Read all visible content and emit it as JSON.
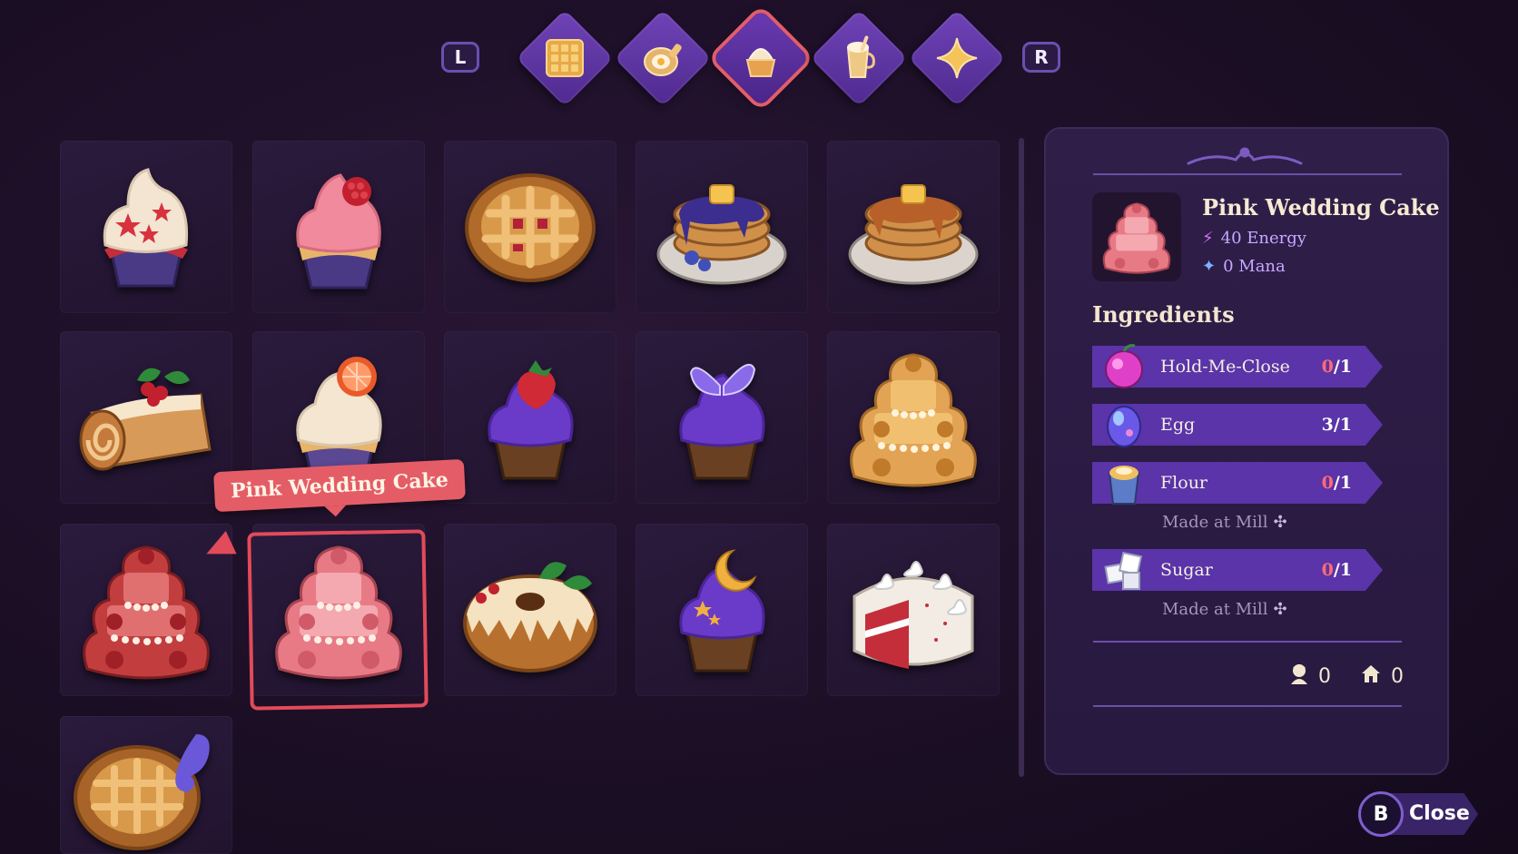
{
  "tabs": {
    "left_shoulder": "L",
    "right_shoulder": "R",
    "items": [
      {
        "icon": "waffle-icon"
      },
      {
        "icon": "pan-icon"
      },
      {
        "icon": "cupcake-icon",
        "active": true
      },
      {
        "icon": "drink-icon"
      },
      {
        "icon": "sparkle-icon"
      }
    ]
  },
  "grid": {
    "items": [
      {
        "name": "star-cupcake"
      },
      {
        "name": "raspberry-cupcake"
      },
      {
        "name": "lattice-pie"
      },
      {
        "name": "blueberry-pancakes"
      },
      {
        "name": "syrup-pancakes"
      },
      {
        "name": "holly-log-cake"
      },
      {
        "name": "grapefruit-cupcake"
      },
      {
        "name": "strawberry-purple-cupcake"
      },
      {
        "name": "butterfly-cupcake"
      },
      {
        "name": "golden-wedding-cake"
      },
      {
        "name": "red-wedding-cake"
      },
      {
        "name": "pink-wedding-cake",
        "selected": true
      },
      {
        "name": "bundt-cake"
      },
      {
        "name": "moon-cupcake"
      },
      {
        "name": "red-velvet-cake"
      },
      {
        "name": "berry-pie"
      }
    ],
    "tooltip": "Pink Wedding Cake"
  },
  "detail": {
    "title": "Pink Wedding Cake",
    "energy": "40 Energy",
    "mana": "0 Mana",
    "ingredients_heading": "Ingredients",
    "ingredients": [
      {
        "name": "Hold-Me-Close",
        "have": "0",
        "need": "/1",
        "icon": "apple-icon"
      },
      {
        "name": "Egg",
        "have": "3",
        "need": "/1",
        "icon": "egg-icon"
      },
      {
        "name": "Flour",
        "have": "0",
        "need": "/1",
        "icon": "flour-icon",
        "note": "Made at Mill"
      },
      {
        "name": "Sugar",
        "have": "0",
        "need": "/1",
        "icon": "sugar-icon",
        "note": "Made at Mill"
      }
    ],
    "counter_villager": "0",
    "counter_house": "0"
  },
  "close": {
    "button": "B",
    "label": "Close"
  }
}
